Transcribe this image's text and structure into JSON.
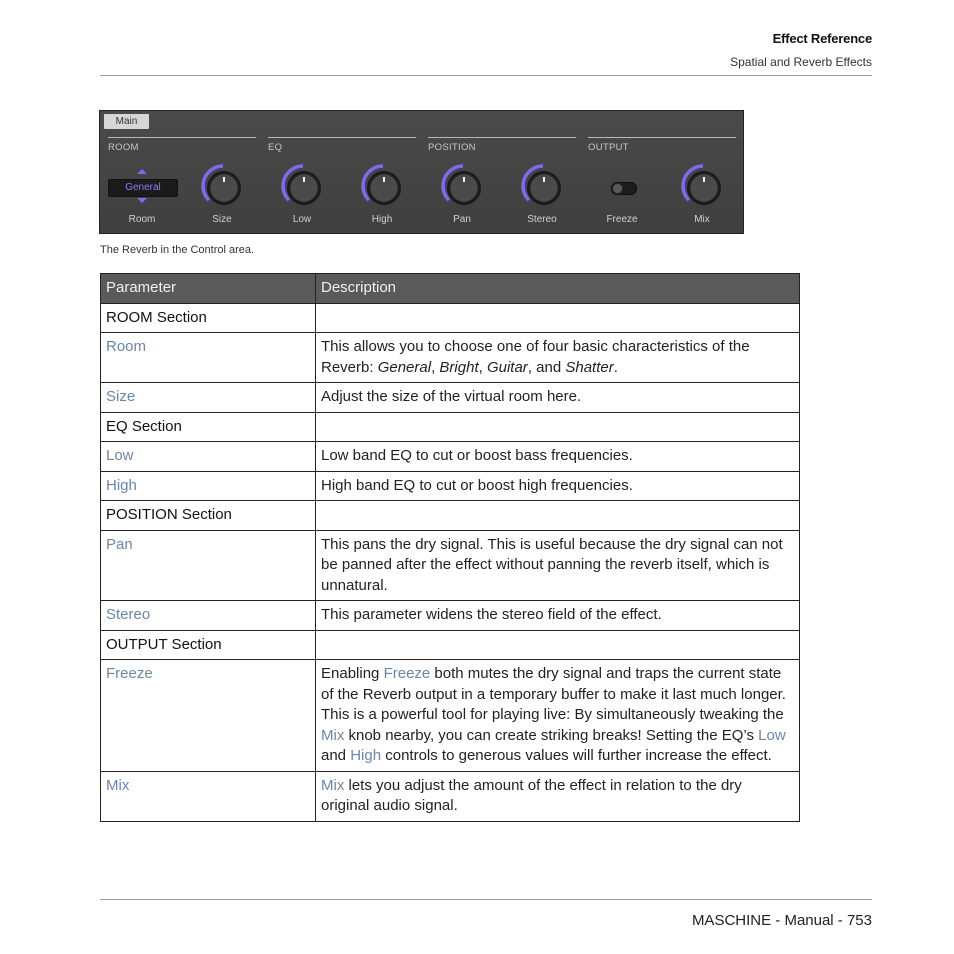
{
  "header": {
    "title": "Effect Reference",
    "subtitle": "Spatial and Reverb Effects"
  },
  "panel": {
    "tab": "Main",
    "sections": [
      "ROOM",
      "EQ",
      "POSITION",
      "OUTPUT"
    ],
    "room_selector": "General",
    "controls": [
      {
        "label": "Room",
        "type": "selector"
      },
      {
        "label": "Size",
        "type": "knob",
        "value": 0.5
      },
      {
        "label": "Low",
        "type": "knob",
        "value": 0.5
      },
      {
        "label": "High",
        "type": "knob",
        "value": 0.5
      },
      {
        "label": "Pan",
        "type": "knob",
        "value": 0.5
      },
      {
        "label": "Stereo",
        "type": "knob",
        "value": 0.5
      },
      {
        "label": "Freeze",
        "type": "toggle",
        "value": false
      },
      {
        "label": "Mix",
        "type": "knob",
        "value": 0.5
      }
    ],
    "accent_color": "#7a6cf0"
  },
  "caption": "The Reverb in the Control area.",
  "table": {
    "headers": [
      "Parameter",
      "Description"
    ],
    "rows": [
      {
        "section": "ROOM Section"
      },
      {
        "param": "Room",
        "desc_html": "This allows you to choose one of four basic characteristics of the Reverb: <i>General</i>, <i>Bright</i>, <i>Guitar</i>, and <i>Shatter</i>."
      },
      {
        "param": "Size",
        "desc_html": "Adjust the size of the virtual room here."
      },
      {
        "section": "EQ Section"
      },
      {
        "param": "Low",
        "desc_html": "Low band EQ to cut or boost bass frequencies."
      },
      {
        "param": "High",
        "desc_html": "High band EQ to cut or boost high frequencies."
      },
      {
        "section": "POSITION Section"
      },
      {
        "param": "Pan",
        "desc_html": "This pans the dry signal. This is useful because the dry signal can not be panned after the effect without panning the reverb itself, which is unnatural."
      },
      {
        "param": "Stereo",
        "desc_html": "This parameter widens the stereo field of the effect."
      },
      {
        "section": "OUTPUT Section"
      },
      {
        "param": "Freeze",
        "desc_html": "Enabling <span class=\"link\">Freeze</span> both mutes the dry signal and traps the current state of the Reverb output in a temporary buffer to make it last much longer. This is a powerful tool for playing live: By simultaneously tweaking the <span class=\"link\">Mix</span> knob nearby, you can create striking breaks! Setting the EQ’s <span class=\"link\">Low</span> and <span class=\"link\">High</span> controls to generous values will further increase the effect."
      },
      {
        "param": "Mix",
        "desc_html": "<span class=\"link\">Mix</span> lets you adjust the amount of the effect in relation to the dry original audio signal."
      }
    ]
  },
  "footer": "MASCHINE - Manual - 753",
  "colors": {
    "link": "#6b86ac",
    "table_header_bg": "#5a5a5a"
  }
}
